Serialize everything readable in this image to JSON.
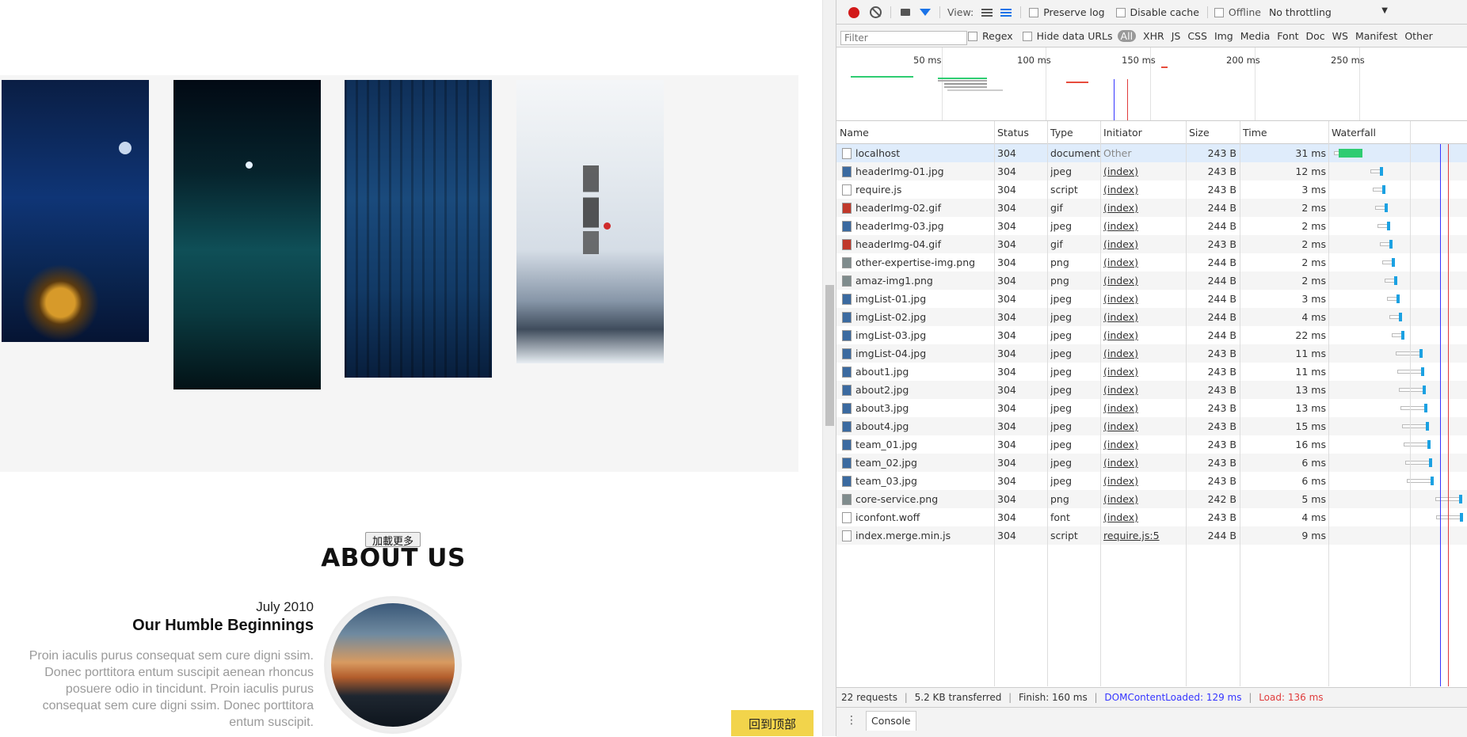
{
  "page": {
    "load_more_label": "加載更多",
    "about_title": "ABOUT US",
    "about_date": "July 2010",
    "about_heading": "Our Humble Beginnings",
    "about_text": "Proin iaculis purus consequat sem cure digni ssim. Donec porttitora entum suscipit aenean rhoncus posuere odio in tincidunt. Proin iaculis purus consequat sem cure digni ssim. Donec porttitora entum suscipit.",
    "back_to_top_label": "回到顶部"
  },
  "devtools": {
    "toolbar": {
      "view_label": "View:",
      "preserve_log_label": "Preserve log",
      "disable_cache_label": "Disable cache",
      "offline_label": "Offline",
      "throttling_value": "No throttling"
    },
    "filter_bar": {
      "filter_placeholder": "Filter",
      "regex_label": "Regex",
      "hide_data_urls_label": "Hide data URLs",
      "all_label": "All",
      "types": [
        "XHR",
        "JS",
        "CSS",
        "Img",
        "Media",
        "Font",
        "Doc",
        "WS",
        "Manifest",
        "Other"
      ]
    },
    "overview_ticks": [
      "50 ms",
      "100 ms",
      "150 ms",
      "200 ms",
      "250 ms"
    ],
    "columns": {
      "name": "Name",
      "status": "Status",
      "type": "Type",
      "initiator": "Initiator",
      "size": "Size",
      "time": "Time",
      "waterfall": "Waterfall"
    },
    "rows": [
      {
        "name": "localhost",
        "status": "304",
        "type": "document",
        "initiator": "Other",
        "size": "243 B",
        "time": "31 ms"
      },
      {
        "name": "headerImg-01.jpg",
        "status": "304",
        "type": "jpeg",
        "initiator": "(index)",
        "size": "243 B",
        "time": "12 ms"
      },
      {
        "name": "require.js",
        "status": "304",
        "type": "script",
        "initiator": "(index)",
        "size": "243 B",
        "time": "3 ms"
      },
      {
        "name": "headerImg-02.gif",
        "status": "304",
        "type": "gif",
        "initiator": "(index)",
        "size": "244 B",
        "time": "2 ms"
      },
      {
        "name": "headerImg-03.jpg",
        "status": "304",
        "type": "jpeg",
        "initiator": "(index)",
        "size": "244 B",
        "time": "2 ms"
      },
      {
        "name": "headerImg-04.gif",
        "status": "304",
        "type": "gif",
        "initiator": "(index)",
        "size": "243 B",
        "time": "2 ms"
      },
      {
        "name": "other-expertise-img.png",
        "status": "304",
        "type": "png",
        "initiator": "(index)",
        "size": "244 B",
        "time": "2 ms"
      },
      {
        "name": "amaz-img1.png",
        "status": "304",
        "type": "png",
        "initiator": "(index)",
        "size": "244 B",
        "time": "2 ms"
      },
      {
        "name": "imgList-01.jpg",
        "status": "304",
        "type": "jpeg",
        "initiator": "(index)",
        "size": "244 B",
        "time": "3 ms"
      },
      {
        "name": "imgList-02.jpg",
        "status": "304",
        "type": "jpeg",
        "initiator": "(index)",
        "size": "244 B",
        "time": "4 ms"
      },
      {
        "name": "imgList-03.jpg",
        "status": "304",
        "type": "jpeg",
        "initiator": "(index)",
        "size": "244 B",
        "time": "22 ms"
      },
      {
        "name": "imgList-04.jpg",
        "status": "304",
        "type": "jpeg",
        "initiator": "(index)",
        "size": "243 B",
        "time": "11 ms"
      },
      {
        "name": "about1.jpg",
        "status": "304",
        "type": "jpeg",
        "initiator": "(index)",
        "size": "243 B",
        "time": "11 ms"
      },
      {
        "name": "about2.jpg",
        "status": "304",
        "type": "jpeg",
        "initiator": "(index)",
        "size": "243 B",
        "time": "13 ms"
      },
      {
        "name": "about3.jpg",
        "status": "304",
        "type": "jpeg",
        "initiator": "(index)",
        "size": "243 B",
        "time": "13 ms"
      },
      {
        "name": "about4.jpg",
        "status": "304",
        "type": "jpeg",
        "initiator": "(index)",
        "size": "243 B",
        "time": "15 ms"
      },
      {
        "name": "team_01.jpg",
        "status": "304",
        "type": "jpeg",
        "initiator": "(index)",
        "size": "243 B",
        "time": "16 ms"
      },
      {
        "name": "team_02.jpg",
        "status": "304",
        "type": "jpeg",
        "initiator": "(index)",
        "size": "243 B",
        "time": "6 ms"
      },
      {
        "name": "team_03.jpg",
        "status": "304",
        "type": "jpeg",
        "initiator": "(index)",
        "size": "243 B",
        "time": "6 ms"
      },
      {
        "name": "core-service.png",
        "status": "304",
        "type": "png",
        "initiator": "(index)",
        "size": "242 B",
        "time": "5 ms"
      },
      {
        "name": "iconfont.woff",
        "status": "304",
        "type": "font",
        "initiator": "(index)",
        "size": "243 B",
        "time": "4 ms"
      },
      {
        "name": "index.merge.min.js",
        "status": "304",
        "type": "script",
        "initiator": "require.js:5",
        "size": "244 B",
        "time": "9 ms"
      }
    ],
    "status_bar": {
      "requests": "22 requests",
      "transferred": "5.2 KB transferred",
      "finish": "Finish: 160 ms",
      "dom_content_loaded": "DOMContentLoaded: 129 ms",
      "load": "Load: 136 ms"
    },
    "drawer_tab": "Console",
    "colors": {
      "record": "#d21a1a",
      "dcl_line": "#3535ff",
      "load_line": "#e03c3c",
      "bar_waiting": "#2ecc71",
      "bar_download": "#1ba1e2"
    }
  }
}
